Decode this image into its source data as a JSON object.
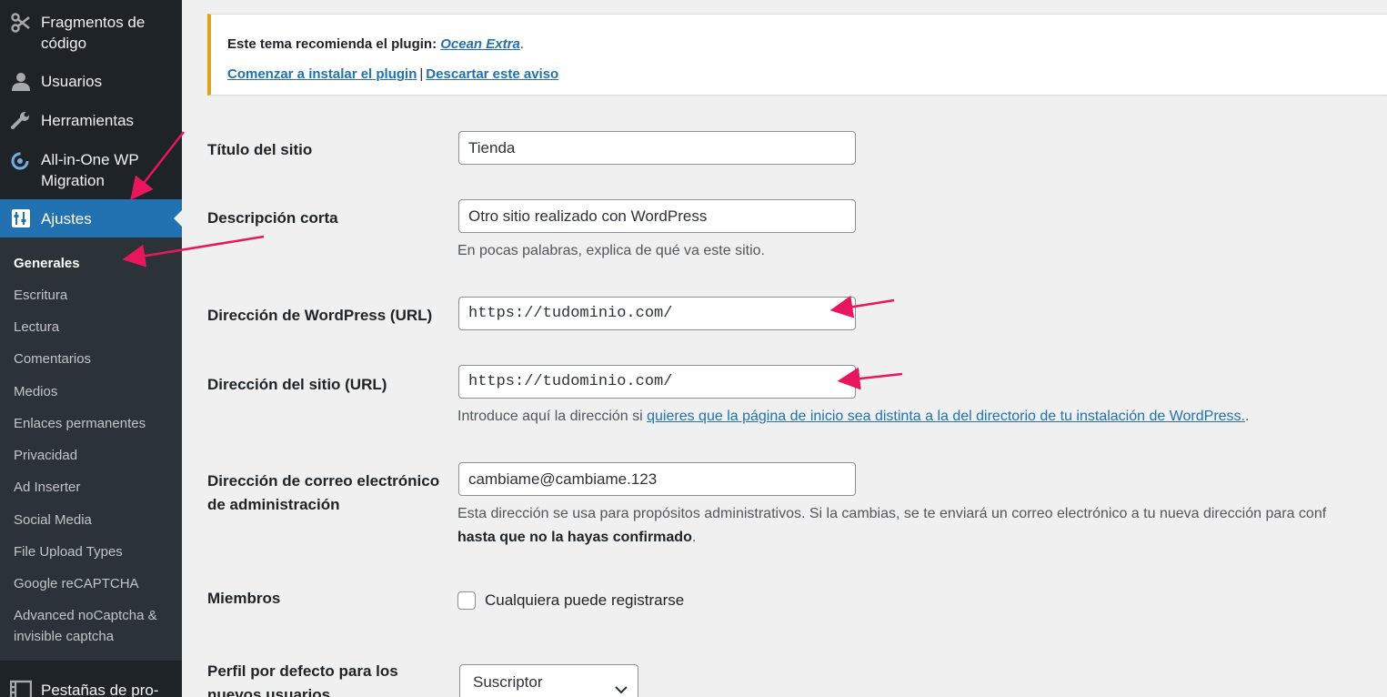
{
  "sidebar": {
    "menu": {
      "snippets": "Fragmentos de código",
      "users": "Usuarios",
      "tools": "Herramientas",
      "migration": "All-in-One WP Migration",
      "settings": "Ajustes",
      "tabs": "Pestañas de pro-"
    },
    "submenu": [
      "Generales",
      "Escritura",
      "Lectura",
      "Comentarios",
      "Medios",
      "Enlaces permanentes",
      "Privacidad",
      "Ad Inserter",
      "Social Media",
      "File Upload Types",
      "Google reCAPTCHA",
      "Advanced noCaptcha & invisible captcha"
    ]
  },
  "notice": {
    "text": "Este tema recomienda el plugin: ",
    "plugin": "Ocean Extra",
    "period": ".",
    "install_link": "Comenzar a instalar el plugin",
    "separator": "|",
    "dismiss_link": "Descartar este aviso"
  },
  "form": {
    "site_title": {
      "label": "Título del sitio",
      "value": "Tienda"
    },
    "tagline": {
      "label": "Descripción corta",
      "value": "Otro sitio realizado con WordPress",
      "description": "En pocas palabras, explica de qué va este sitio."
    },
    "wp_url": {
      "label": "Dirección de WordPress (URL)",
      "value": "https://tudominio.com/"
    },
    "site_url": {
      "label": "Dirección del sitio (URL)",
      "value": "https://tudominio.com/",
      "description_pre": "Introduce aquí la dirección si ",
      "description_link": "quieres que la página de inicio sea distinta a la del directorio de tu instalación de WordPress.",
      "description_post": "."
    },
    "admin_email": {
      "label": "Dirección de correo electrónico de administración",
      "value": "cambiame@cambiame.123",
      "description_line1": "Esta dirección se usa para propósitos administrativos. Si la cambias, se te enviará un correo electrónico a tu nueva dirección para conf",
      "description_line2": "hasta que no la hayas confirmado",
      "description_line2_end": "."
    },
    "membership": {
      "label": "Miembros",
      "checkbox_label": "Cualquiera puede registrarse",
      "checked": false
    },
    "default_role": {
      "label": "Perfil por defecto para los nuevos usuarios",
      "value": "Suscriptor"
    }
  },
  "colors": {
    "sidebar_bg": "#1d2327",
    "submenu_bg": "#2c3338",
    "accent": "#2271b1",
    "notice_border": "#dba617",
    "annotation_arrow": "#e8175d"
  }
}
